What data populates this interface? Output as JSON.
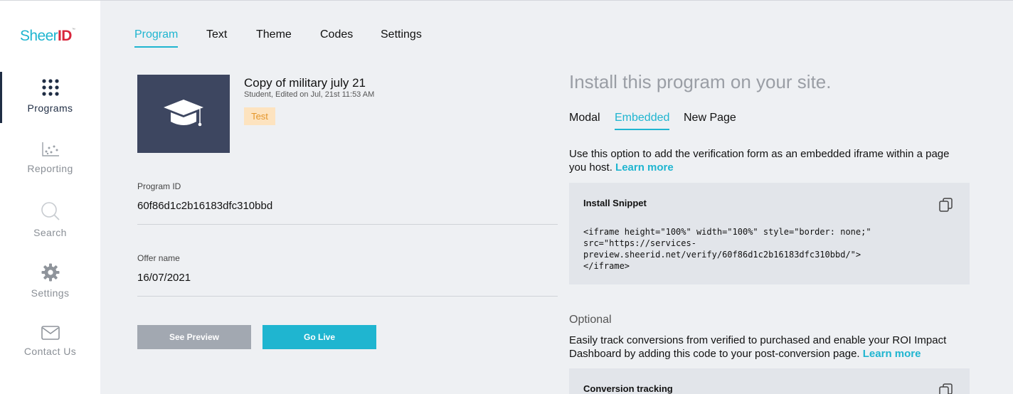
{
  "brand": {
    "sheer": "Sheer",
    "id": "ID",
    "tm": "™"
  },
  "sidebar": {
    "items": [
      {
        "label": "Programs",
        "icon": "grid-dots-icon",
        "active": true
      },
      {
        "label": "Reporting",
        "icon": "scatter-chart-icon"
      },
      {
        "label": "Search",
        "icon": "search-icon"
      },
      {
        "label": "Settings",
        "icon": "gear-icon"
      },
      {
        "label": "Contact Us",
        "icon": "envelope-icon"
      }
    ]
  },
  "tabs": [
    "Program",
    "Text",
    "Theme",
    "Codes",
    "Settings"
  ],
  "program": {
    "title": "Copy of military july 21",
    "subtitle": "Student, Edited on Jul, 21st 11:53 AM",
    "badge": "Test",
    "icon": "graduation-cap-icon",
    "id_label": "Program ID",
    "id_value": "60f86d1c2b16183dfc310bbd",
    "offer_label": "Offer name",
    "offer_value": "16/07/2021",
    "preview_label": "See Preview",
    "golive_label": "Go Live"
  },
  "install": {
    "title": "Install this program on your site.",
    "tabs": [
      "Modal",
      "Embedded",
      "New Page"
    ],
    "active_tab": "Embedded",
    "description": "Use this option to add the verification form as an embedded iframe within a page you host.",
    "learn_more": "Learn more",
    "snippet_title": "Install Snippet",
    "snippet_code": "<iframe height=\"100%\" width=\"100%\" style=\"border: none;\"\nsrc=\"https://services-\npreview.sheerid.net/verify/60f86d1c2b16183dfc310bbd/\">\n</iframe>",
    "optional_label": "Optional",
    "optional_desc": "Easily track conversions from verified to purchased and enable your ROI Impact Dashboard by adding this code to your post-conversion page.",
    "optional_learn_more": "Learn more",
    "conversion_title": "Conversion tracking"
  },
  "colors": {
    "accent": "#1fb5d0",
    "navy": "#3d4660",
    "badge_bg": "#fde3bf",
    "badge_text": "#e4962a",
    "brand_red": "#d8263c"
  }
}
